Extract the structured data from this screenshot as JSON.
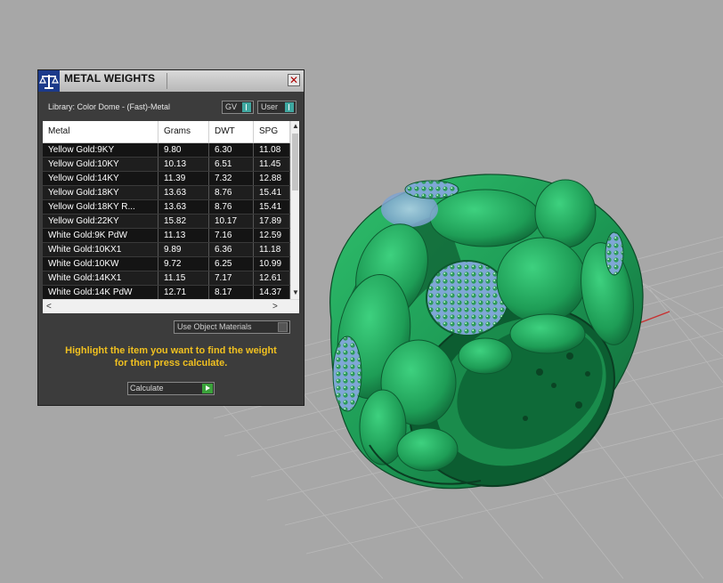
{
  "panel": {
    "title": "METAL WEIGHTS",
    "close_glyph": "✕",
    "logo_icon": "scale-icon",
    "library_label": "Library: Color Dome - (Fast)-Metal",
    "toggles": [
      {
        "label": "GV"
      },
      {
        "label": "User"
      }
    ],
    "columns": [
      "Metal",
      "Grams",
      "DWT",
      "SPG"
    ],
    "rows": [
      [
        "Yellow Gold:9KY",
        "9.80",
        "6.30",
        "11.08"
      ],
      [
        "Yellow Gold:10KY",
        "10.13",
        "6.51",
        "11.45"
      ],
      [
        "Yellow Gold:14KY",
        "11.39",
        "7.32",
        "12.88"
      ],
      [
        "Yellow Gold:18KY",
        "13.63",
        "8.76",
        "15.41"
      ],
      [
        "Yellow Gold:18KY R...",
        "13.63",
        "8.76",
        "15.41"
      ],
      [
        "Yellow Gold:22KY",
        "15.82",
        "10.17",
        "17.89"
      ],
      [
        "White Gold:9K PdW",
        "11.13",
        "7.16",
        "12.59"
      ],
      [
        "White Gold:10KX1",
        "9.89",
        "6.36",
        "11.18"
      ],
      [
        "White Gold:10KW",
        "9.72",
        "6.25",
        "10.99"
      ],
      [
        "White Gold:14KX1",
        "11.15",
        "7.17",
        "12.61"
      ],
      [
        "White Gold:14K PdW",
        "12.71",
        "8.17",
        "14.37"
      ]
    ],
    "use_object_materials": "Use Object Materials",
    "instruction_line1": "Highlight the item you want to find the weight",
    "instruction_line2": "for then press calculate.",
    "calculate_label": "Calculate",
    "colors": {
      "instruction": "#f0c020",
      "toggle_on": "#3fa7a0",
      "go": "#3aa23a"
    }
  },
  "viewport": {
    "object": "green-ring-model",
    "grid": true,
    "background": "#a7a7a7",
    "ring_color": "#1f9a55",
    "gem_color": "#8fb6e0",
    "axis_x_color": "#c83030",
    "axis_y_color": "#2fa02f"
  }
}
